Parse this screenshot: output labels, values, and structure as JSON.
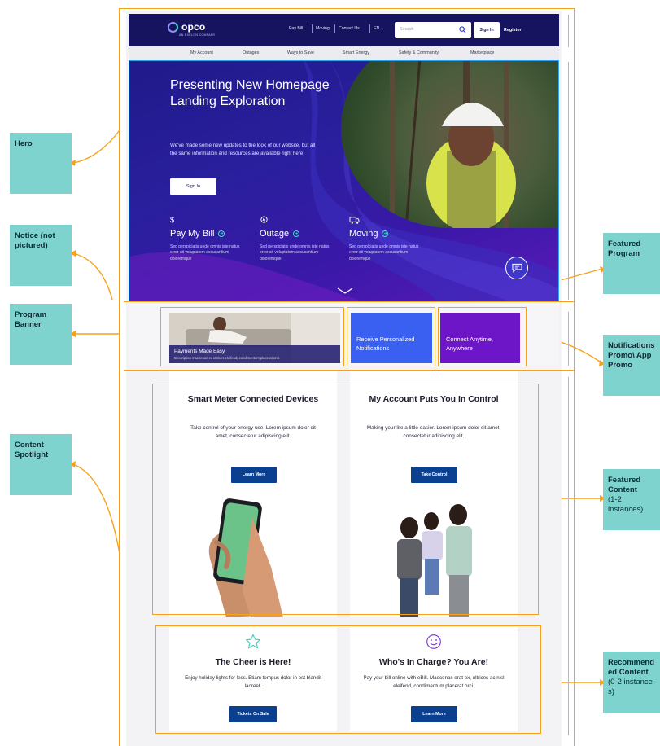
{
  "annotations": {
    "hero": "Hero",
    "notice": "Notice (not pictured)",
    "program_banner": "Program Banner",
    "content_spotlight": "Content Spotlight",
    "featured_program": "Featured Program",
    "notifications": "Notifications Promo\\ App Promo",
    "featured_content": "Featured Content",
    "featured_content_sub": "(1-2 instances)",
    "recommended_content": "Recommended Content",
    "recommended_content_sub": "(0-2 instances)"
  },
  "header": {
    "logo": "opco",
    "logo_tagline": "AN EXELON COMPANY",
    "utility_links": [
      "Pay Bill",
      "Moving",
      "Contact Us",
      "EN"
    ],
    "search_placeholder": "Search",
    "sign_in": "Sign In",
    "register": "Register"
  },
  "nav": [
    "My Account",
    "Outages",
    "Ways to Save",
    "Smart Energy",
    "Safety & Community",
    "Marketplace"
  ],
  "hero": {
    "title": "Presenting New Homepage Landing Exploration",
    "body": "We've made some new updates to the look of our website, but all the same information and resources are available right here.",
    "button": "Sign In",
    "actions": [
      {
        "icon": "$",
        "title": "Pay My Bill",
        "desc": "Sed perspiciatis unde omnis iste natus error sit voluptatem accusantium doloremque"
      },
      {
        "icon": "outage-icon",
        "title": "Outage",
        "desc": "Sed perspiciatis unde omnis iste natus error sit voluptatem accusantium doloremque"
      },
      {
        "icon": "truck-icon",
        "title": "Moving",
        "desc": "Sed perspiciatis unde omnis iste natus error sit voluptatem accusantium doloremque"
      }
    ]
  },
  "programs": {
    "featured_title": "Payments Made Easy",
    "featured_desc": "Description maecenas ex ultrices eleifend, condimentum placerat orci.",
    "notifications": "Receive Personalized Notifications",
    "app": "Connect Anytime, Anywhere"
  },
  "spotlight": [
    {
      "title": "Smart Meter Connected Devices",
      "body": "Take control of your energy use. Lorem ipsum dolor sit amet, consectetur adipiscing elit.",
      "button": "Learn More"
    },
    {
      "title": "My Account Puts You In Control",
      "body": "Making your life a little easier. Lorem ipsum dolor sit amet, consectetur adipiscing elit.",
      "button": "Take Control"
    }
  ],
  "recommended": [
    {
      "icon": "star-icon",
      "title": "The Cheer is Here!",
      "body": "Enjoy holiday lights for less. Etiam tempus dolor in est blandit laoreet.",
      "button": "Tickets On Sale"
    },
    {
      "icon": "smiley-icon",
      "title": "Who's In Charge? You Are!",
      "body": "Pay your bill online with eBill. Maecenas erat ex, ultrices ac nisl eleifend, condimentum placerat orci.",
      "button": "Learn More"
    }
  ],
  "colors": {
    "annotation": "#7fd3cf",
    "frame": "#f5a11c",
    "brand_navy": "#16145e",
    "button_blue": "#0b3f8f",
    "notif_blue": "#3a60f2",
    "app_purple": "#6d16c8",
    "teal_accent": "#3ee0c8"
  }
}
